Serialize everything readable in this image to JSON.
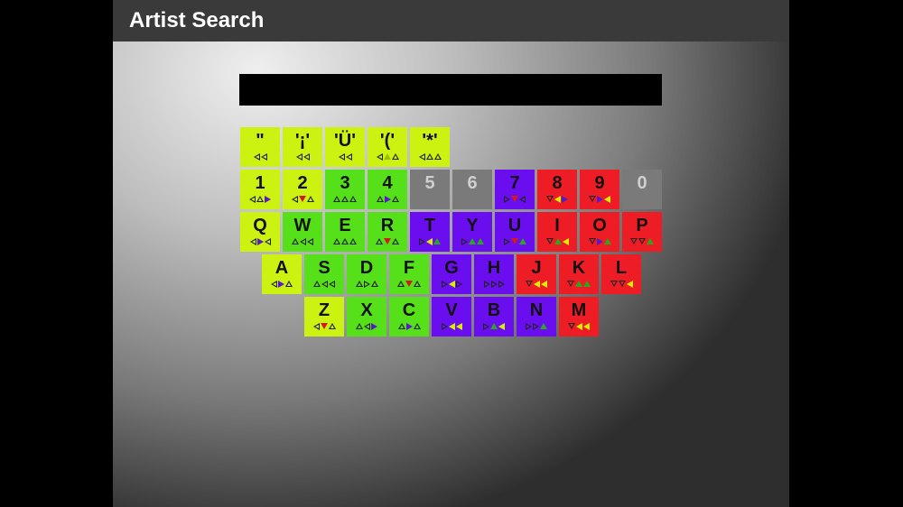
{
  "title": "Artist Search",
  "search": {
    "value": ""
  },
  "colors": {
    "yellow": "#ccf211",
    "green": "#55e01a",
    "purple": "#6a0ef0",
    "red": "#ee1c24",
    "grey": "#7a7a7a",
    "dark_yellow": "#9bc000",
    "icon_purple": "#5a19c9",
    "icon_red": "#d21919",
    "icon_green": "#2aa81a",
    "icon_yellow": "#d8f000"
  },
  "keys": [
    {
      "label": "\"",
      "row": 0,
      "col": 0,
      "color": "yellow",
      "arrows": [
        [
          "left",
          "o"
        ],
        [
          "left",
          "o"
        ]
      ]
    },
    {
      "label": "'¡'",
      "row": 0,
      "col": 1,
      "color": "yellow",
      "arrows": [
        [
          "left",
          "o"
        ],
        [
          "left",
          "o"
        ]
      ]
    },
    {
      "label": "'Ü'",
      "row": 0,
      "col": 2,
      "color": "yellow",
      "arrows": [
        [
          "left",
          "o"
        ],
        [
          "left",
          "o"
        ]
      ]
    },
    {
      "label": "'('",
      "row": 0,
      "col": 3,
      "color": "yellow",
      "arrows": [
        [
          "left",
          "o"
        ],
        [
          "up",
          "dark_yellow"
        ],
        [
          "up",
          "o"
        ]
      ]
    },
    {
      "label": "'*'",
      "row": 0,
      "col": 4,
      "color": "yellow",
      "arrows": [
        [
          "left",
          "o"
        ],
        [
          "up",
          "o"
        ],
        [
          "up",
          "o"
        ]
      ]
    },
    {
      "label": "1",
      "row": 1,
      "col": 0,
      "color": "yellow",
      "arrows": [
        [
          "left",
          "o"
        ],
        [
          "up",
          "o"
        ],
        [
          "right",
          "icon_purple"
        ]
      ]
    },
    {
      "label": "2",
      "row": 1,
      "col": 1,
      "color": "yellow",
      "arrows": [
        [
          "left",
          "o"
        ],
        [
          "down",
          "icon_red"
        ],
        [
          "up",
          "o"
        ]
      ]
    },
    {
      "label": "3",
      "row": 1,
      "col": 2,
      "color": "green",
      "arrows": [
        [
          "up",
          "o"
        ],
        [
          "up",
          "o"
        ],
        [
          "up",
          "o"
        ]
      ]
    },
    {
      "label": "4",
      "row": 1,
      "col": 3,
      "color": "green",
      "arrows": [
        [
          "up",
          "o"
        ],
        [
          "right",
          "icon_purple"
        ],
        [
          "up",
          "o"
        ]
      ]
    },
    {
      "label": "5",
      "row": 1,
      "col": 4,
      "color": "grey",
      "arrows": []
    },
    {
      "label": "6",
      "row": 1,
      "col": 5,
      "color": "grey",
      "arrows": []
    },
    {
      "label": "7",
      "row": 1,
      "col": 6,
      "color": "purple",
      "arrows": [
        [
          "right",
          "o"
        ],
        [
          "down",
          "icon_red"
        ],
        [
          "left",
          "o"
        ]
      ]
    },
    {
      "label": "8",
      "row": 1,
      "col": 7,
      "color": "red",
      "arrows": [
        [
          "down",
          "o"
        ],
        [
          "left",
          "icon_yellow"
        ],
        [
          "right",
          "icon_purple"
        ]
      ]
    },
    {
      "label": "9",
      "row": 1,
      "col": 8,
      "color": "red",
      "arrows": [
        [
          "down",
          "o"
        ],
        [
          "right",
          "icon_purple"
        ],
        [
          "left",
          "icon_yellow"
        ]
      ]
    },
    {
      "label": "0",
      "row": 1,
      "col": 9,
      "color": "grey",
      "arrows": []
    },
    {
      "label": "Q",
      "row": 2,
      "col": 0,
      "color": "yellow",
      "arrows": [
        [
          "left",
          "o"
        ],
        [
          "right",
          "icon_purple"
        ],
        [
          "left",
          "o"
        ]
      ]
    },
    {
      "label": "W",
      "row": 2,
      "col": 1,
      "color": "green",
      "arrows": [
        [
          "up",
          "o"
        ],
        [
          "left",
          "o"
        ],
        [
          "left",
          "o"
        ]
      ]
    },
    {
      "label": "E",
      "row": 2,
      "col": 2,
      "color": "green",
      "arrows": [
        [
          "up",
          "o"
        ],
        [
          "up",
          "o"
        ],
        [
          "up",
          "o"
        ]
      ]
    },
    {
      "label": "R",
      "row": 2,
      "col": 3,
      "color": "green",
      "arrows": [
        [
          "up",
          "o"
        ],
        [
          "down",
          "icon_red"
        ],
        [
          "up",
          "o"
        ]
      ]
    },
    {
      "label": "T",
      "row": 2,
      "col": 4,
      "color": "purple",
      "arrows": [
        [
          "right",
          "o"
        ],
        [
          "left",
          "icon_yellow"
        ],
        [
          "up",
          "icon_green"
        ]
      ]
    },
    {
      "label": "Y",
      "row": 2,
      "col": 5,
      "color": "purple",
      "arrows": [
        [
          "right",
          "o"
        ],
        [
          "up",
          "icon_green"
        ],
        [
          "up",
          "icon_green"
        ]
      ]
    },
    {
      "label": "U",
      "row": 2,
      "col": 6,
      "color": "purple",
      "arrows": [
        [
          "right",
          "o"
        ],
        [
          "down",
          "icon_red"
        ],
        [
          "up",
          "icon_green"
        ]
      ]
    },
    {
      "label": "I",
      "row": 2,
      "col": 7,
      "color": "red",
      "arrows": [
        [
          "down",
          "o"
        ],
        [
          "up",
          "icon_green"
        ],
        [
          "left",
          "icon_yellow"
        ]
      ]
    },
    {
      "label": "O",
      "row": 2,
      "col": 8,
      "color": "red",
      "arrows": [
        [
          "down",
          "o"
        ],
        [
          "right",
          "icon_purple"
        ],
        [
          "up",
          "icon_green"
        ]
      ]
    },
    {
      "label": "P",
      "row": 2,
      "col": 9,
      "color": "red",
      "arrows": [
        [
          "down",
          "o"
        ],
        [
          "down",
          "o"
        ],
        [
          "up",
          "icon_green"
        ]
      ]
    },
    {
      "label": "A",
      "row": 3,
      "col": 0,
      "color": "yellow",
      "arrows": [
        [
          "left",
          "o"
        ],
        [
          "right",
          "icon_purple"
        ],
        [
          "up",
          "o"
        ]
      ]
    },
    {
      "label": "S",
      "row": 3,
      "col": 1,
      "color": "green",
      "arrows": [
        [
          "up",
          "o"
        ],
        [
          "left",
          "o"
        ],
        [
          "left",
          "o"
        ]
      ]
    },
    {
      "label": "D",
      "row": 3,
      "col": 2,
      "color": "green",
      "arrows": [
        [
          "up",
          "o"
        ],
        [
          "right",
          "o"
        ],
        [
          "up",
          "o"
        ]
      ]
    },
    {
      "label": "F",
      "row": 3,
      "col": 3,
      "color": "green",
      "arrows": [
        [
          "up",
          "o"
        ],
        [
          "down",
          "icon_red"
        ],
        [
          "up",
          "o"
        ]
      ]
    },
    {
      "label": "G",
      "row": 3,
      "col": 4,
      "color": "purple",
      "arrows": [
        [
          "right",
          "o"
        ],
        [
          "left",
          "icon_yellow"
        ],
        [
          "right",
          "o"
        ]
      ]
    },
    {
      "label": "H",
      "row": 3,
      "col": 5,
      "color": "purple",
      "arrows": [
        [
          "right",
          "o"
        ],
        [
          "right",
          "o"
        ],
        [
          "right",
          "o"
        ]
      ]
    },
    {
      "label": "J",
      "row": 3,
      "col": 6,
      "color": "red",
      "arrows": [
        [
          "down",
          "o"
        ],
        [
          "left",
          "icon_yellow"
        ],
        [
          "left",
          "icon_yellow"
        ]
      ]
    },
    {
      "label": "K",
      "row": 3,
      "col": 7,
      "color": "red",
      "arrows": [
        [
          "down",
          "o"
        ],
        [
          "up",
          "icon_green"
        ],
        [
          "up",
          "icon_green"
        ]
      ]
    },
    {
      "label": "L",
      "row": 3,
      "col": 8,
      "color": "red",
      "arrows": [
        [
          "down",
          "o"
        ],
        [
          "down",
          "o"
        ],
        [
          "left",
          "icon_yellow"
        ]
      ]
    },
    {
      "label": "Z",
      "row": 4,
      "col": 0,
      "color": "yellow",
      "arrows": [
        [
          "left",
          "o"
        ],
        [
          "down",
          "icon_red"
        ],
        [
          "up",
          "o"
        ]
      ]
    },
    {
      "label": "X",
      "row": 4,
      "col": 1,
      "color": "green",
      "arrows": [
        [
          "up",
          "o"
        ],
        [
          "left",
          "o"
        ],
        [
          "right",
          "icon_purple"
        ]
      ]
    },
    {
      "label": "C",
      "row": 4,
      "col": 2,
      "color": "green",
      "arrows": [
        [
          "up",
          "o"
        ],
        [
          "right",
          "icon_purple"
        ],
        [
          "up",
          "o"
        ]
      ]
    },
    {
      "label": "V",
      "row": 4,
      "col": 3,
      "color": "purple",
      "arrows": [
        [
          "right",
          "o"
        ],
        [
          "left",
          "icon_yellow"
        ],
        [
          "left",
          "icon_yellow"
        ]
      ]
    },
    {
      "label": "B",
      "row": 4,
      "col": 4,
      "color": "purple",
      "arrows": [
        [
          "right",
          "o"
        ],
        [
          "up",
          "icon_green"
        ],
        [
          "left",
          "icon_yellow"
        ]
      ]
    },
    {
      "label": "N",
      "row": 4,
      "col": 5,
      "color": "purple",
      "arrows": [
        [
          "right",
          "o"
        ],
        [
          "right",
          "o"
        ],
        [
          "up",
          "icon_green"
        ]
      ]
    },
    {
      "label": "M",
      "row": 4,
      "col": 6,
      "color": "red",
      "arrows": [
        [
          "down",
          "o"
        ],
        [
          "left",
          "icon_yellow"
        ],
        [
          "left",
          "icon_yellow"
        ]
      ]
    }
  ]
}
